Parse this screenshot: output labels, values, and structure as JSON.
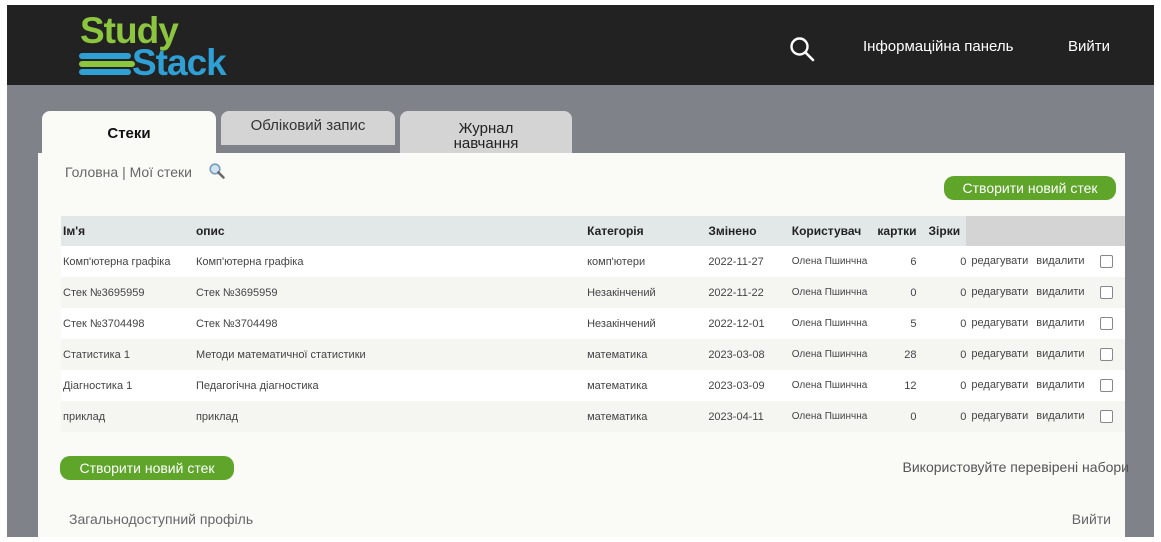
{
  "logo": {
    "line1": "Study",
    "line2": "Stack"
  },
  "header": {
    "dashboard_label": "Інформаційна панель",
    "logout_label": "Вийти"
  },
  "tabs": [
    {
      "label": "Стеки"
    },
    {
      "label": "Обліковий запис"
    },
    {
      "label": "Журнал навчання"
    }
  ],
  "breadcrumb": "Головна | Мої стеки",
  "create_button_label": "Створити новий стек",
  "table": {
    "columns": [
      "Ім'я",
      "опис",
      "Категорія",
      "Змінено",
      "Користувач",
      "картки",
      "Зірки",
      ""
    ],
    "rows": [
      {
        "name": "Комп'ютерна графіка",
        "description": "Комп'ютерна графіка",
        "category": "комп'ютери",
        "modified": "2022-11-27",
        "user": "Олена Пшинчна",
        "cards": "6",
        "stars": "0"
      },
      {
        "name": "Стек №3695959",
        "description": "Стек №3695959",
        "category": "Незакінчений",
        "modified": "2022-11-22",
        "user": "Олена Пшинчна",
        "cards": "0",
        "stars": "0"
      },
      {
        "name": "Стек №3704498",
        "description": "Стек №3704498",
        "category": "Незакінчений",
        "modified": "2022-12-01",
        "user": "Олена Пшинчна",
        "cards": "5",
        "stars": "0"
      },
      {
        "name": "Статистика 1",
        "description": "Методи математичної статистики",
        "category": "математика",
        "modified": "2023-03-08",
        "user": "Олена Пшинчна",
        "cards": "28",
        "stars": "0"
      },
      {
        "name": "Діагностика 1",
        "description": "Педагогічна діагностика",
        "category": "математика",
        "modified": "2023-03-09",
        "user": "Олена Пшинчна",
        "cards": "12",
        "stars": "0"
      },
      {
        "name": "приклад",
        "description": "приклад",
        "category": "математика",
        "modified": "2023-04-11",
        "user": "Олена Пшинчна",
        "cards": "0",
        "stars": "0"
      }
    ],
    "edit_label": "редагувати",
    "delete_label": "видалити"
  },
  "verified_sets_label": "Використовуйте перевірені набори",
  "footer": {
    "public_profile_label": "Загальнодоступний профіль",
    "logout_label": "Вийти"
  },
  "colors": {
    "topbar": "#222222",
    "background": "#7f8289",
    "accent_green": "#5ea52a",
    "logo_green": "#8cc63f",
    "logo_blue": "#2fa0d6"
  },
  "icons": [
    "search-icon",
    "magnifier-icon",
    "checkbox-icon"
  ]
}
